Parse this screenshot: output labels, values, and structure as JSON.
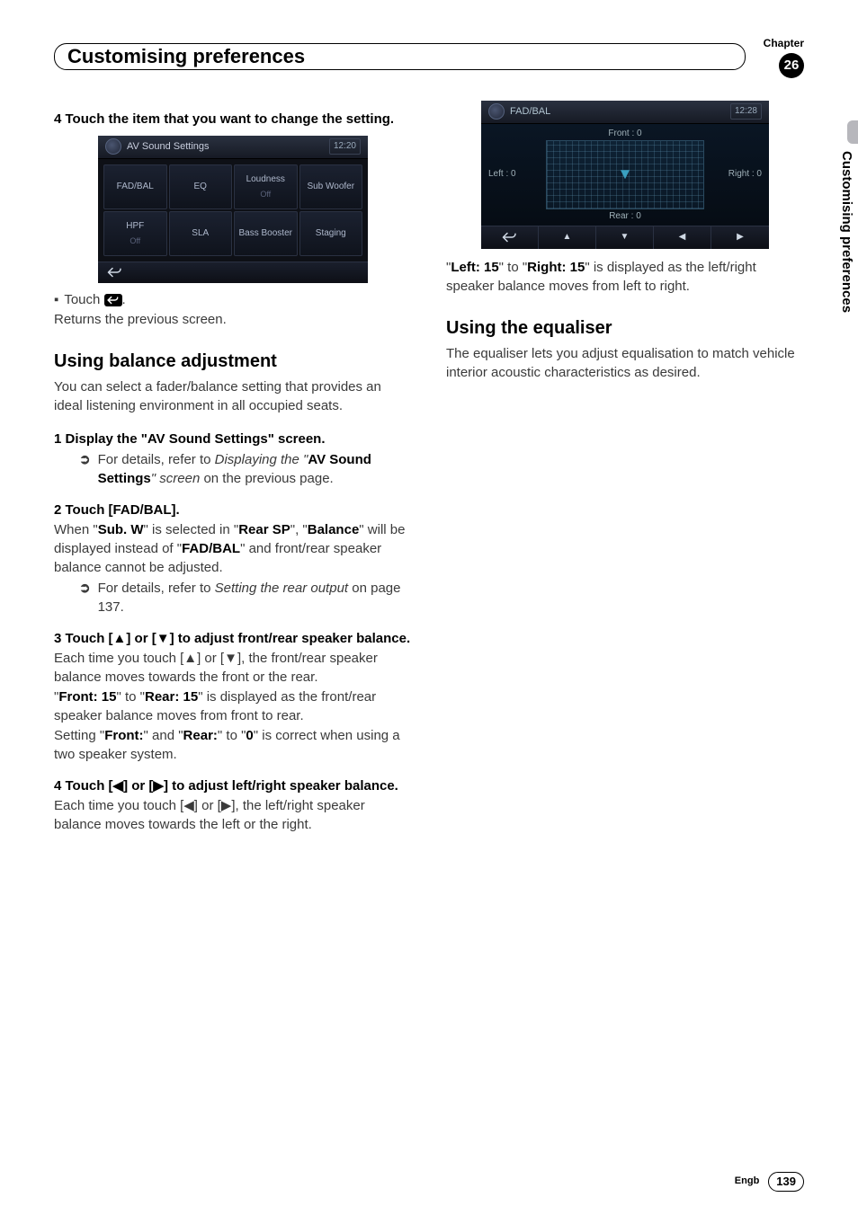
{
  "chapter_label": "Chapter",
  "chapter_number": "26",
  "section_title": "Customising preferences",
  "side_tab": "Customising preferences",
  "col1": {
    "step4_title": "4    Touch the item that you want to change the setting.",
    "ss1": {
      "title": "AV Sound Settings",
      "time": "12:20",
      "buttons": [
        {
          "label": "FAD/BAL",
          "sub": ""
        },
        {
          "label": "EQ",
          "sub": ""
        },
        {
          "label": "Loudness",
          "sub": "Off"
        },
        {
          "label": "Sub Woofer",
          "sub": ""
        },
        {
          "label": "HPF",
          "sub": "Off"
        },
        {
          "label": "SLA",
          "sub": ""
        },
        {
          "label": "Bass Booster",
          "sub": ""
        },
        {
          "label": "Staging",
          "sub": ""
        }
      ]
    },
    "touch_back": "Touch ",
    "touch_back_after": ".",
    "returns": "Returns the previous screen.",
    "h2a": "Using balance adjustment",
    "h2a_body": "You can select a fader/balance setting that provides an ideal listening environment in all occupied seats.",
    "step1": "1    Display the \"AV Sound Settings\" screen.",
    "ref1_a": "For details, refer to ",
    "ref1_b": "Displaying the \"",
    "ref1_c": "AV Sound Settings",
    "ref1_d": "\" screen",
    "ref1_e": " on the previous page.",
    "step2": "2    Touch [FAD/BAL].",
    "s2_a": "When \"",
    "s2_subw": "Sub. W",
    "s2_b": "\" is selected in \"",
    "s2_rearsp": "Rear SP",
    "s2_c": "\", \"",
    "s2_balance": "Balance",
    "s2_d": "\" will be displayed instead of \"",
    "s2_fadbal": "FAD/BAL",
    "s2_e": "\" and front/rear speaker balance cannot be adjusted.",
    "ref2_a": "For details, refer to ",
    "ref2_b": "Setting the rear output",
    "ref2_c": " on page 137.",
    "step3": "3    Touch [▲] or [▼] to adjust front/rear speaker balance.",
    "s3_body": "Each time you touch [▲] or [▼], the front/rear speaker balance moves towards the front or the rear.",
    "s3_a": "\"",
    "s3_front15": "Front: 15",
    "s3_b": "\" to \"",
    "s3_rear15": "Rear: 15",
    "s3_c": "\" is displayed as the front/rear speaker balance moves from front to rear.",
    "s3_d": "Setting \"",
    "s3_front": "Front:",
    "s3_e": "\" and \"",
    "s3_rear": "Rear:",
    "s3_f": "\" to \"",
    "s3_zero": "0",
    "s3_g": "\" is correct when using a two speaker system.",
    "step4b": "4    Touch [◀] or [▶] to adjust left/right speaker balance.",
    "s4_body": "Each time you touch [◀] or [▶], the left/right speaker balance moves towards the left or the right."
  },
  "col2": {
    "ss2": {
      "title": "FAD/BAL",
      "time": "12:28",
      "front": "Front :  0",
      "rear": "Rear :  0",
      "left": "Left :  0",
      "right": "Right :  0"
    },
    "lr_a": "\"",
    "lr_left15": "Left: 15",
    "lr_b": "\" to \"",
    "lr_right15": "Right: 15",
    "lr_c": "\" is displayed as the left/right speaker balance moves from left to right.",
    "h2b": "Using the equaliser",
    "h2b_body": "The equaliser lets you adjust equalisation to match vehicle interior acoustic characteristics as desired."
  },
  "footer": {
    "lang": "Engb",
    "page": "139"
  }
}
